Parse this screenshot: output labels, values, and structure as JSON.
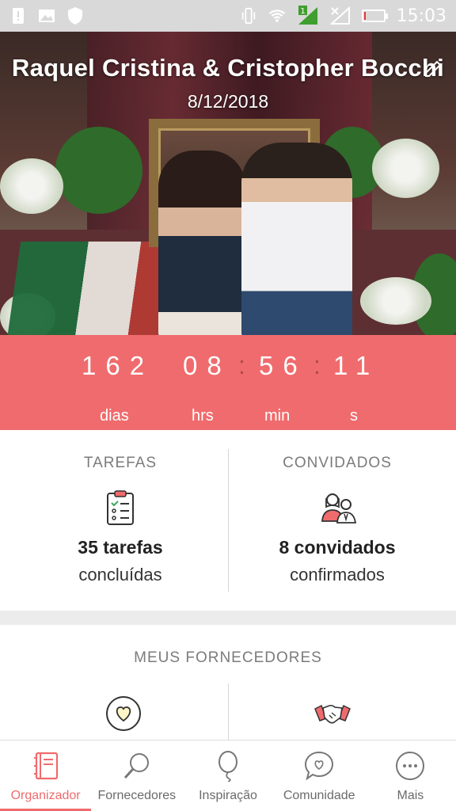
{
  "status_bar": {
    "time": "15:03",
    "icons": [
      "notification-alert-icon",
      "image-icon",
      "shield-icon",
      "vibrate-icon",
      "wifi-icon",
      "cellular-signal-icon",
      "no-signal-icon",
      "battery-low-icon"
    ],
    "carrier_badge": "1",
    "battery_level": 0.1
  },
  "hero": {
    "title": "Raquel Cristina & Cristopher Bocchi",
    "date": "8/12/2018"
  },
  "countdown": {
    "days": "162",
    "hours": "08",
    "minutes": "56",
    "seconds": "11",
    "separator": ":",
    "labels": {
      "days": "dias",
      "hours": "hrs",
      "minutes": "min",
      "seconds": "s"
    }
  },
  "stats": {
    "tasks": {
      "title": "TAREFAS",
      "count": "35 tarefas",
      "sub": "concluídas",
      "icon": "clipboard-checklist-icon"
    },
    "guests": {
      "title": "CONVIDADOS",
      "count": "8 convidados",
      "sub": "confirmados",
      "icon": "couple-icon"
    }
  },
  "suppliers": {
    "title": "MEUS FORNECEDORES",
    "icons": [
      "heart-circle-icon",
      "handshake-icon"
    ]
  },
  "bottom_nav": {
    "items": [
      {
        "label": "Organizador",
        "icon": "planner-icon",
        "active": true
      },
      {
        "label": "Fornecedores",
        "icon": "search-icon",
        "active": false
      },
      {
        "label": "Inspiração",
        "icon": "balloon-icon",
        "active": false
      },
      {
        "label": "Comunidade",
        "icon": "chat-heart-icon",
        "active": false
      },
      {
        "label": "Mais",
        "icon": "more-icon",
        "active": false
      }
    ]
  },
  "colors": {
    "accent": "#f06b6d",
    "status_bar": "#d9d9d9",
    "separator": "#b24a4c",
    "text_muted": "#7b7b7b"
  }
}
